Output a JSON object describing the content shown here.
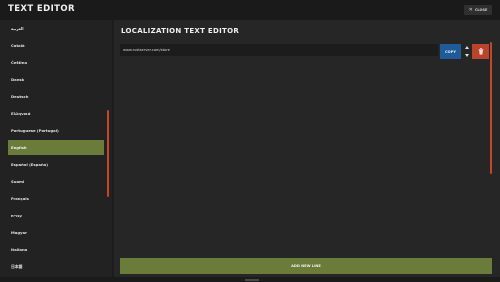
{
  "header": {
    "title": "TEXT EDITOR",
    "close_label": "CLOSE"
  },
  "sidebar": {
    "languages": [
      {
        "label": "العربية",
        "active": false
      },
      {
        "label": "Català",
        "active": false
      },
      {
        "label": "Čeština",
        "active": false
      },
      {
        "label": "Dansk",
        "active": false
      },
      {
        "label": "Deutsch",
        "active": false
      },
      {
        "label": "Ελληνικά",
        "active": false
      },
      {
        "label": "Portuguese (Portugal)",
        "active": false
      },
      {
        "label": "English",
        "active": true
      },
      {
        "label": "Español (España)",
        "active": false
      },
      {
        "label": "Suomi",
        "active": false
      },
      {
        "label": "Français",
        "active": false
      },
      {
        "label": "עברית",
        "active": false
      },
      {
        "label": "Magyar",
        "active": false
      },
      {
        "label": "Italiano",
        "active": false
      },
      {
        "label": "日本語",
        "active": false
      }
    ]
  },
  "main": {
    "title": "LOCALIZATION TEXT EDITOR",
    "rows": [
      {
        "value": "www.rustserver.com/store"
      }
    ],
    "copy_label": "COPY",
    "add_label": "ADD NEW LINE"
  },
  "colors": {
    "accent_green": "#6b7c3a",
    "danger_red": "#b8442c",
    "copy_blue": "#1f5b99"
  }
}
